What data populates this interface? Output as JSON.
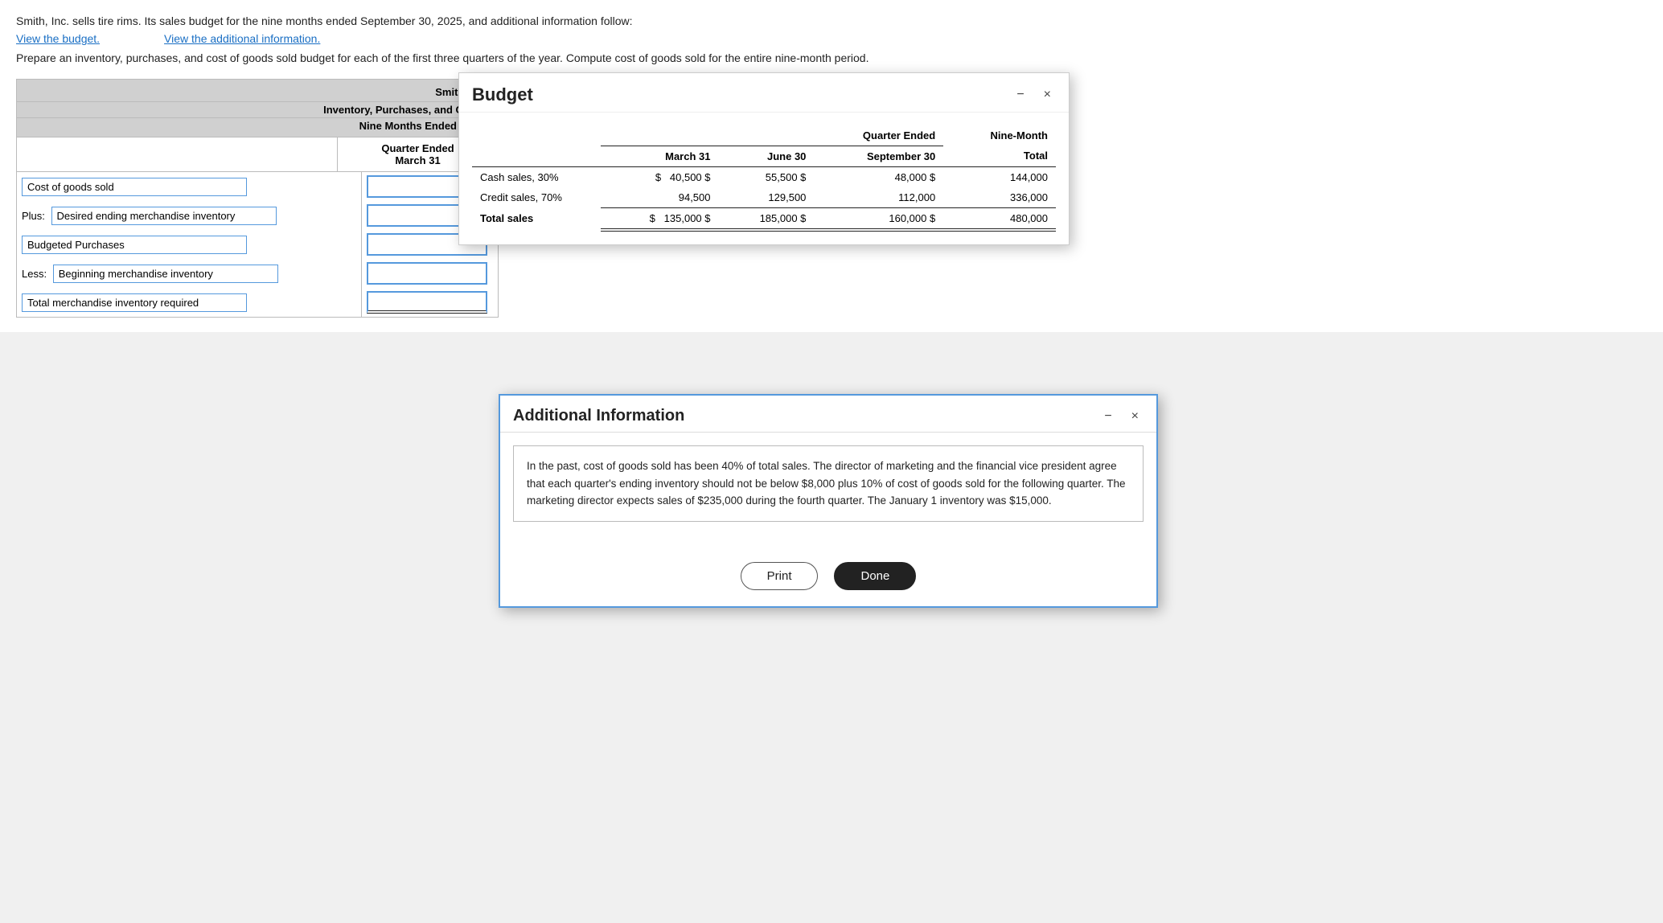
{
  "page": {
    "intro": "Smith, Inc. sells tire rims. Its sales budget for the nine months ended September 30, 2025, and additional information follow:",
    "link_budget": "View the budget.",
    "link_additional": "View the additional information.",
    "prepare": "Prepare an inventory, purchases, and cost of goods sold budget for each of the first three quarters of the year. Compute cost of goods sold for the entire nine-month period."
  },
  "spreadsheet": {
    "company": "Smith, Inc.",
    "title": "Inventory, Purchases, and Cost o",
    "period": "Nine Months Ended Septe",
    "col_quarter_ended": "Quarter Ended",
    "col_march31": "March 31",
    "rows": [
      {
        "label": "Cost of goods sold",
        "prefix": "",
        "type": "simple",
        "underline": false
      },
      {
        "label": "Desired ending merchandise inventory",
        "prefix": "Plus:",
        "type": "plus",
        "underline": false
      },
      {
        "label": "Budgeted Purchases",
        "prefix": "",
        "type": "simple",
        "underline": false
      },
      {
        "label": "Beginning merchandise inventory",
        "prefix": "Less:",
        "type": "less",
        "underline": false
      },
      {
        "label": "Total merchandise inventory required",
        "prefix": "",
        "type": "simple",
        "underline": true
      }
    ]
  },
  "budget_modal": {
    "title": "Budget",
    "minimize": "−",
    "close": "×",
    "table": {
      "quarter_header": "Quarter Ended",
      "nine_month": "Nine-Month",
      "cols": [
        "March 31",
        "June 30",
        "September 30",
        "Total"
      ],
      "rows": [
        {
          "label": "Cash sales, 30%",
          "dollar_sign": "$",
          "values": [
            "40,500",
            "55,500",
            "48,000",
            "144,000"
          ],
          "dollar_signs": [
            "$",
            "",
            "$",
            "",
            "$",
            "",
            "$",
            ""
          ]
        },
        {
          "label": "Credit sales, 70%",
          "values": [
            "94,500",
            "129,500",
            "112,000",
            "336,000"
          ]
        },
        {
          "label": "Total sales",
          "values": [
            "135,000",
            "185,000",
            "160,000",
            "480,000"
          ],
          "dollar_sign": "$"
        }
      ]
    }
  },
  "additional_modal": {
    "title": "Additional Information",
    "minimize": "−",
    "close": "×",
    "content": "In the past, cost of goods sold has been 40% of total sales. The director of marketing and the financial vice president agree that each quarter's ending inventory should not be below $8,000 plus 10% of cost of goods sold for the following quarter. The marketing director expects sales of $235,000 during the fourth quarter. The January 1 inventory was $15,000.",
    "btn_print": "Print",
    "btn_done": "Done"
  }
}
